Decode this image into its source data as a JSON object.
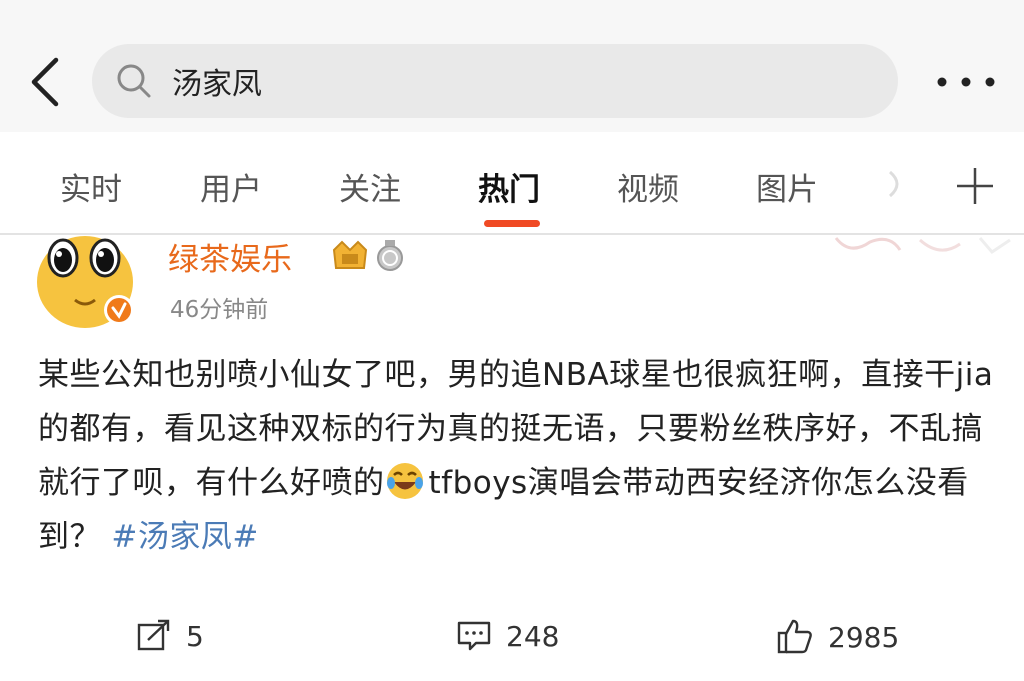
{
  "search": {
    "query": "汤家凤"
  },
  "tabs": [
    {
      "label": "实时"
    },
    {
      "label": "用户"
    },
    {
      "label": "关注"
    },
    {
      "label": "热门"
    },
    {
      "label": "视频"
    },
    {
      "label": "图片"
    }
  ],
  "active_tab": "热门",
  "post": {
    "username": "绿茶娱乐",
    "time": "46分钟前",
    "text_part1": "某些公知也别喷小仙女了吧，男的追NBA球星也很疯狂啊，直接干jia的都有，看见这种双标的行为真的挺无语，只要粉丝秩序好，不乱搞就行了呗，有什么好喷的",
    "text_part2": "tfboys演唱会带动西安经济你怎么没看到？",
    "hashtag": "#汤家凤#"
  },
  "actions": {
    "repost_count": "5",
    "comment_count": "248",
    "like_count": "2985"
  },
  "colors": {
    "accent": "#f04a24",
    "username": "#e8691b",
    "hashtag": "#4b7bb6"
  },
  "icons": [
    "back-arrow-icon",
    "search-icon",
    "more-icon",
    "plus-icon",
    "verified-icon",
    "vip-icon",
    "medal-icon",
    "laughing-emoji-icon",
    "repost-icon",
    "comment-icon",
    "like-icon"
  ]
}
